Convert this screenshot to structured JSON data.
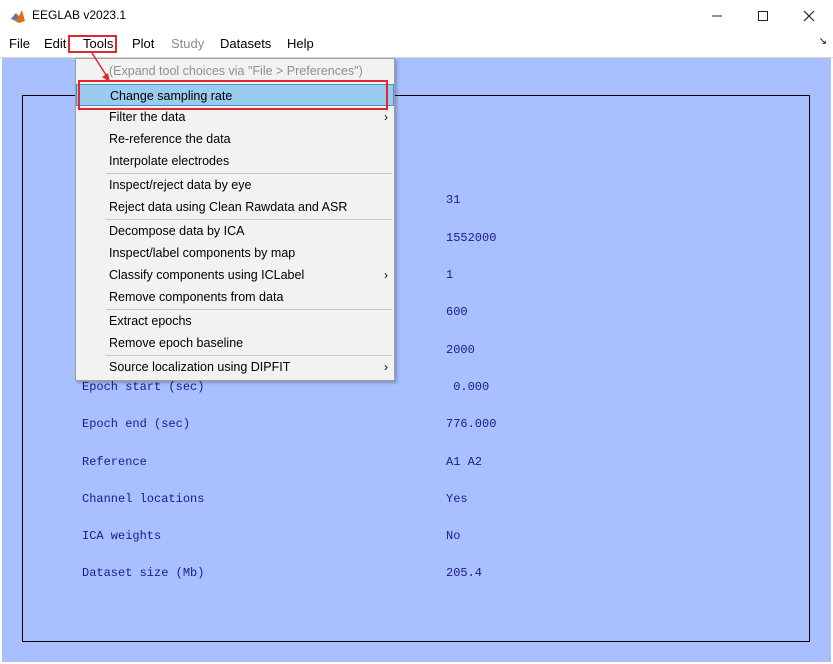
{
  "window": {
    "title": "EEGLAB v2023.1"
  },
  "menubar": {
    "items": [
      {
        "label": "File",
        "disabled": false
      },
      {
        "label": "Edit",
        "disabled": false
      },
      {
        "label": "Tools",
        "disabled": false
      },
      {
        "label": "Plot",
        "disabled": false
      },
      {
        "label": "Study",
        "disabled": true
      },
      {
        "label": "Datasets",
        "disabled": false
      },
      {
        "label": "Help",
        "disabled": false
      }
    ]
  },
  "tools_menu": {
    "items": [
      {
        "label": "(Expand tool choices via \"File > Preferences\")",
        "disabled": true
      },
      {
        "label": "Change sampling rate",
        "selected": true
      },
      {
        "label": "Filter the data",
        "submenu": true
      },
      {
        "label": "Re-reference the data"
      },
      {
        "label": "Interpolate electrodes"
      },
      {
        "label": "Inspect/reject data by eye"
      },
      {
        "label": "Reject data using Clean Rawdata and ASR"
      },
      {
        "label": "Decompose data by ICA"
      },
      {
        "label": "Inspect/label components by map"
      },
      {
        "label": "Classify components using ICLabel",
        "submenu": true
      },
      {
        "label": "Remove components from data"
      },
      {
        "label": "Extract epochs"
      },
      {
        "label": "Remove epoch baseline"
      },
      {
        "label": "Source localization using DIPFIT",
        "submenu": true
      }
    ]
  },
  "dataset_info": {
    "labels": [
      "Epoch start (sec)",
      "Epoch end (sec)",
      "Reference",
      "Channel locations",
      "ICA weights",
      "Dataset size (Mb)"
    ],
    "values": [
      "31",
      "1552000",
      "1",
      "600",
      "2000",
      " 0.000",
      "776.000",
      "A1 A2",
      "Yes",
      "No",
      "205.4"
    ]
  },
  "colors": {
    "background": "#a8c0ff",
    "text": "#1a1a8c",
    "highlight": "#e0282e",
    "selection": "#99ccee"
  }
}
